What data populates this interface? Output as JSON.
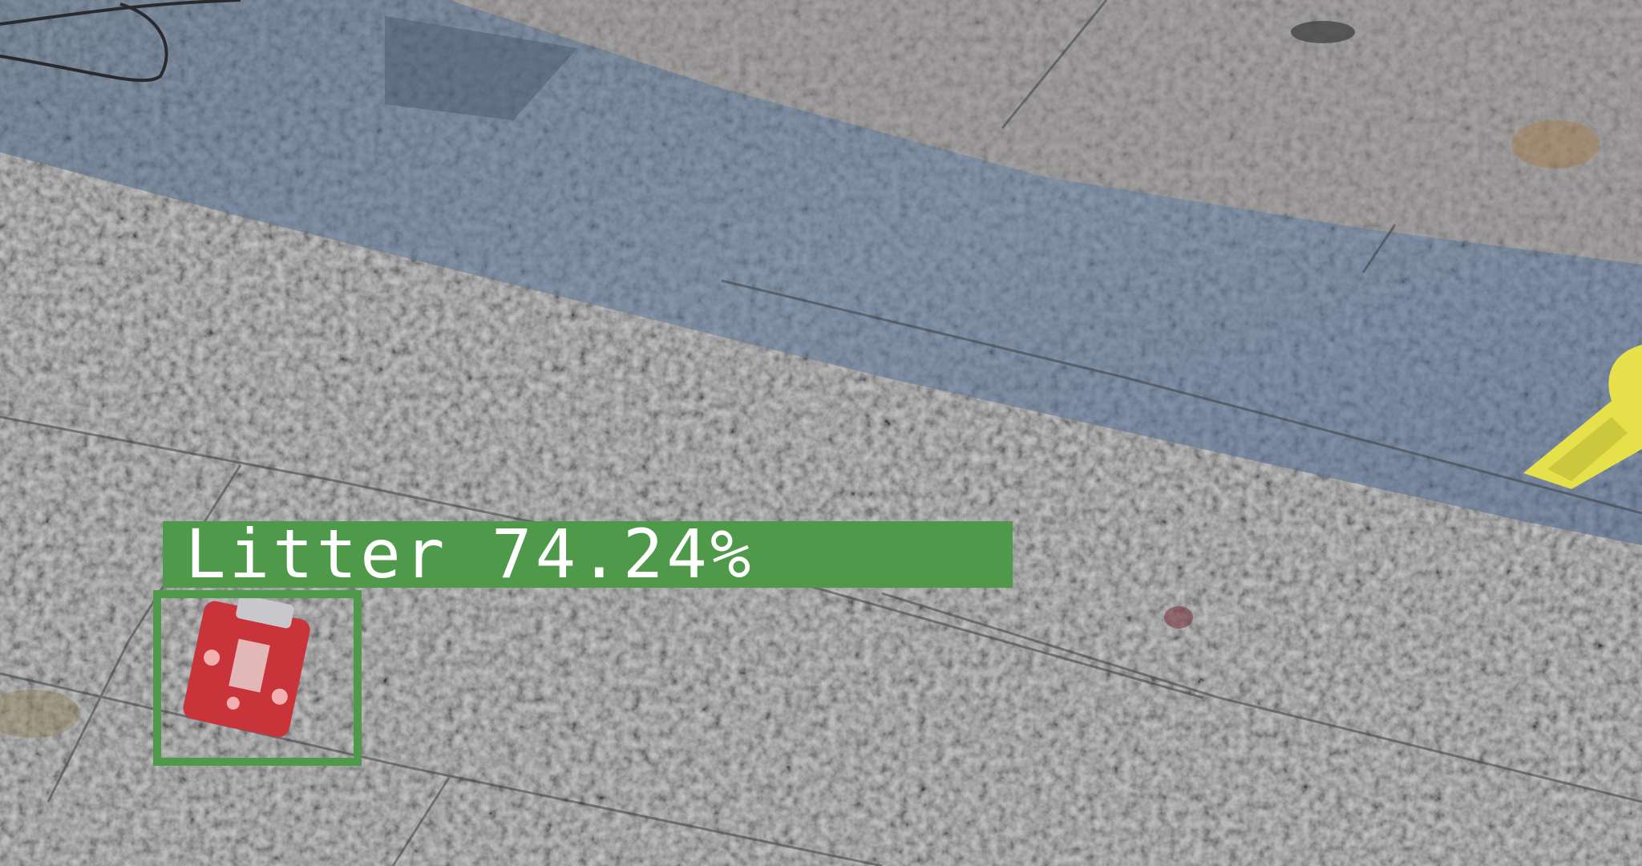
{
  "image": {
    "description_free": true
  },
  "detection": {
    "label_text": "Litter 74.24%",
    "class": "Litter",
    "confidence_percent": 74.24,
    "box_color": "#4f9a4a",
    "label_text_color": "#ffffff"
  },
  "scene_colors": {
    "pavement": "#7d7d7f",
    "blue_strip": "#5d6f8a",
    "litter_red": "#c9333a",
    "litter_yellow": "#e6e04a"
  }
}
